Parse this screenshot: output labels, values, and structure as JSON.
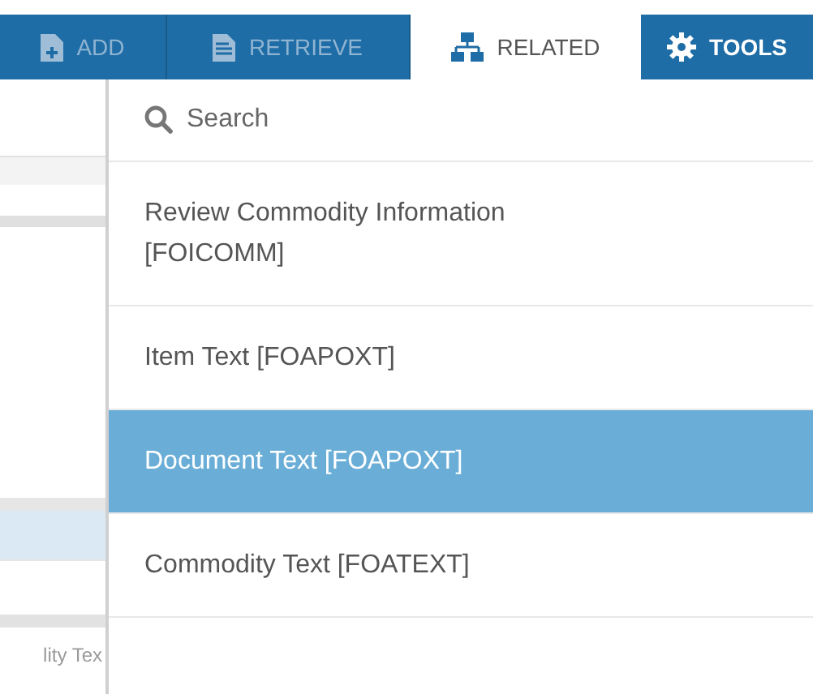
{
  "toolbar": {
    "tabs": [
      {
        "label": "ADD",
        "kind": "add",
        "selected": false
      },
      {
        "label": "RETRIEVE",
        "kind": "retrieve",
        "selected": false
      },
      {
        "label": "RELATED",
        "kind": "related",
        "selected": true
      },
      {
        "label": "TOOLS",
        "kind": "tools",
        "selected": false
      }
    ]
  },
  "background": {
    "cut_text": "lity Tex"
  },
  "related_menu": {
    "search": {
      "placeholder": "Search"
    },
    "items": [
      {
        "label": "Review Commodity Information [FOICOMM]",
        "selected": false
      },
      {
        "label": "Item Text [FOAPOXT]",
        "selected": false
      },
      {
        "label": "Document Text [FOAPOXT]",
        "selected": true
      },
      {
        "label": "Commodity Text [FOATEXT]",
        "selected": false
      }
    ]
  }
}
